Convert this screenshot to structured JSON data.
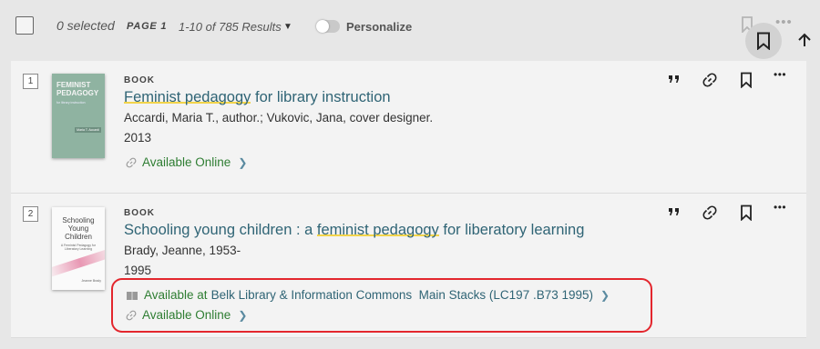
{
  "toolbar": {
    "selected": "0 selected",
    "page": "PAGE 1",
    "results": "1-10 of 785 Results",
    "personalize": "Personalize"
  },
  "records": [
    {
      "number": "1",
      "type": "BOOK",
      "title_before": "",
      "title_highlight": "Feminist pedagogy",
      "title_after": " for library instruction",
      "author": "Accardi, Maria T., author.; Vukovic, Jana, cover designer.",
      "date": "2013",
      "online": "Available Online",
      "cover": {
        "title": "FEMINIST PEDAGOGY",
        "subtitle": "for library instruction",
        "author": "Maria T. Accardi"
      }
    },
    {
      "number": "2",
      "type": "BOOK",
      "title_before": "Schooling young children : a ",
      "title_highlight": "feminist pedagogy",
      "title_after": " for liberatory learning",
      "author": "Brady, Jeanne, 1953-",
      "date": "1995",
      "available_at_prefix": "Available at",
      "location": "Belk Library & Information Commons  Main Stacks (LC197 .B73 1995)",
      "online": "Available Online",
      "cover": {
        "title": "Schooling Young Children",
        "subtitle": "A Feminist Pedagogy for Liberatory Learning",
        "author": "Jeanne Brady"
      }
    }
  ],
  "icons": [
    "checkbox-icon",
    "caret-down-icon",
    "bookmark-icon",
    "more-icon",
    "arrow-up-icon",
    "quote-icon",
    "link-icon",
    "book-icon",
    "chevron-right-icon"
  ],
  "colors": {
    "title": "#2f6475",
    "available": "#2e7d32",
    "highlight_box": "#e3262d",
    "title_underline": "#f2d44a"
  }
}
